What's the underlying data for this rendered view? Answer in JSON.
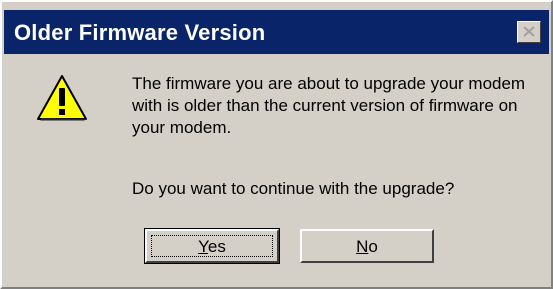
{
  "dialog": {
    "title": "Older Firmware Version",
    "icon": "warning-icon",
    "message": "The firmware you are about to upgrade your modem with is older than the current version of firmware on your modem.",
    "question": "Do you want to continue with the upgrade?",
    "buttons": {
      "yes": {
        "mnemonic": "Y",
        "rest": "es"
      },
      "no": {
        "mnemonic": "N",
        "rest": "o"
      }
    }
  },
  "colors": {
    "titlebar": "#0a246a",
    "dialog_bg": "#d4d0c8",
    "warning_fill": "#ffff00"
  }
}
